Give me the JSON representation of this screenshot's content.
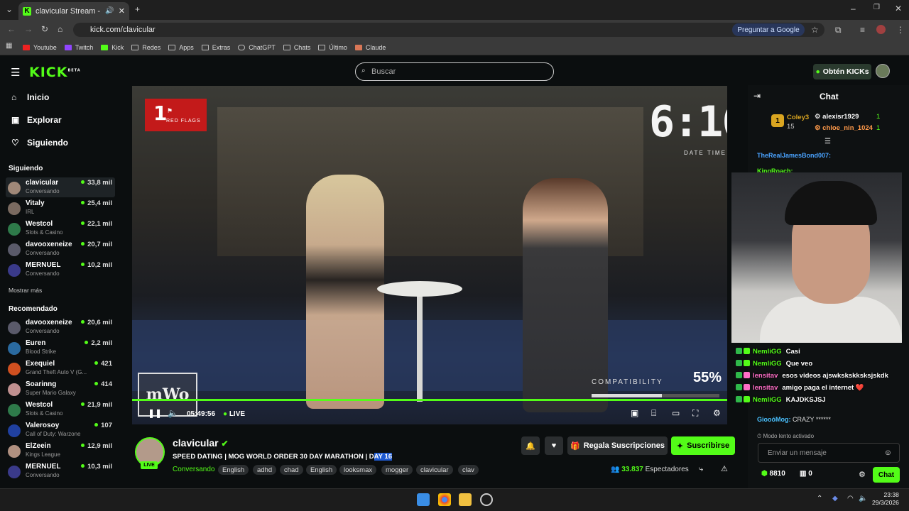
{
  "browser": {
    "tab_title": "clavicular Stream - Watch Li",
    "url": "kick.com/clavicular",
    "ask_google": "Preguntar a Google",
    "bookmarks": [
      "Youtube",
      "Twitch",
      "Kick",
      "Redes",
      "Apps",
      "Extras",
      "ChatGPT",
      "Chats",
      "Último",
      "Claude"
    ]
  },
  "header": {
    "logo": "KICK",
    "logo_sup": "BETA",
    "search_placeholder": "Buscar",
    "get_kicks": "Obtén KICKs"
  },
  "sidebar": {
    "nav": [
      "Inicio",
      "Explorar",
      "Siguiendo"
    ],
    "following_title": "Siguiendo",
    "following": [
      {
        "name": "clavicular",
        "category": "Conversando",
        "viewers": "33,8 mil",
        "color": "#a08878"
      },
      {
        "name": "Vitaly",
        "category": "IRL",
        "viewers": "25,4 mil",
        "color": "#7a6a60"
      },
      {
        "name": "Westcol",
        "category": "Slots & Casino",
        "viewers": "22,1 mil",
        "color": "#2e7a4a"
      },
      {
        "name": "davooxeneize",
        "category": "Conversando",
        "viewers": "20,7 mil",
        "color": "#5a5a6a"
      },
      {
        "name": "MERNUEL",
        "category": "Conversando",
        "viewers": "10,2 mil",
        "color": "#3a3a8a"
      }
    ],
    "show_more": "Mostrar más",
    "recommended_title": "Recomendado",
    "recommended": [
      {
        "name": "davooxeneize",
        "category": "Conversando",
        "viewers": "20,6 mil",
        "color": "#5a5a6a"
      },
      {
        "name": "Euren",
        "category": "Blood Strike",
        "viewers": "2,2 mil",
        "color": "#2a6aa0"
      },
      {
        "name": "Exequiel",
        "category": "Grand Theft Auto V (G...",
        "viewers": "421",
        "color": "#d05020"
      },
      {
        "name": "Soarinng",
        "category": "Super Mario Galaxy",
        "viewers": "414",
        "color": "#c09090"
      },
      {
        "name": "Westcol",
        "category": "Slots & Casino",
        "viewers": "21,9 mil",
        "color": "#2e7a4a"
      },
      {
        "name": "Valerosoy",
        "category": "Call of Duty: Warzone",
        "viewers": "107",
        "color": "#2040a0"
      },
      {
        "name": "ElZeein",
        "category": "Kings League",
        "viewers": "12,9 mil",
        "color": "#b09080"
      },
      {
        "name": "MERNUEL",
        "category": "Conversando",
        "viewers": "10,3 mil",
        "color": "#3a3a8a"
      }
    ]
  },
  "video": {
    "red_flags_count": "1",
    "red_flags_label": "RED FLAGS",
    "timer": "6:16",
    "timer_label": "DATE TIME",
    "compat_label": "COMPATIBILITY",
    "compat_value": "55%",
    "compat_fraction": 0.55,
    "logo_text": "mWo",
    "elapsed": "05:49:56",
    "live_label": "LIVE"
  },
  "webcam_chat": [
    {
      "user": "NemliGG",
      "msg": "Casi",
      "color": "#53fc18"
    },
    {
      "user": "NemliGG",
      "msg": "Que veo",
      "color": "#53fc18"
    },
    {
      "user": "lensitav",
      "msg": "esos videos ajswkskskksksjskdk",
      "color": "#ff6ec7"
    },
    {
      "user": "lensitav",
      "msg": "amigo paga el internet ❤️",
      "color": "#ff6ec7"
    },
    {
      "user": "NemliGG",
      "msg": "KAJDKSJSJ",
      "color": "#53fc18"
    }
  ],
  "stream": {
    "name": "clavicular",
    "live_badge": "LIVE",
    "title_a": "SPEED DATING | MOG WORLD ORDER 30 DAY MARATHON | D",
    "title_b": "AY 16",
    "category": "Conversando",
    "tags": [
      "English",
      "adhd",
      "chad",
      "English",
      "looksmax",
      "mogger",
      "clavicular",
      "clav"
    ],
    "gift_label": "Regala Suscripciones",
    "subscribe_label": "Suscribirse",
    "viewers_count": "33.837",
    "viewers_label": "Espectadores"
  },
  "chat": {
    "title": "Chat",
    "pinned_rank": "1",
    "pinned_user": "Coley3",
    "pinned_count": "15",
    "top_users": [
      {
        "name": "alexisr1929",
        "count": "1"
      },
      {
        "name": "chloe_nin_1024",
        "count": "1"
      }
    ],
    "lines": [
      {
        "user": "TheRealJamesBond007:",
        "msg": "",
        "color": "#4aa3ff"
      },
      {
        "user": "KingRoach:",
        "msg": "",
        "color": "#53fc18"
      },
      {
        "user": "GiooóMog:",
        "msg": "CRAZY ******",
        "color": "#4ac1ff"
      }
    ],
    "slow_mode": "Modo lento activado",
    "input_placeholder": "Enviar un mensaje",
    "points": "8810",
    "other_count": "0",
    "send_label": "Chat"
  },
  "taskbar": {
    "time": "23:38",
    "date": "29/3/2026"
  }
}
